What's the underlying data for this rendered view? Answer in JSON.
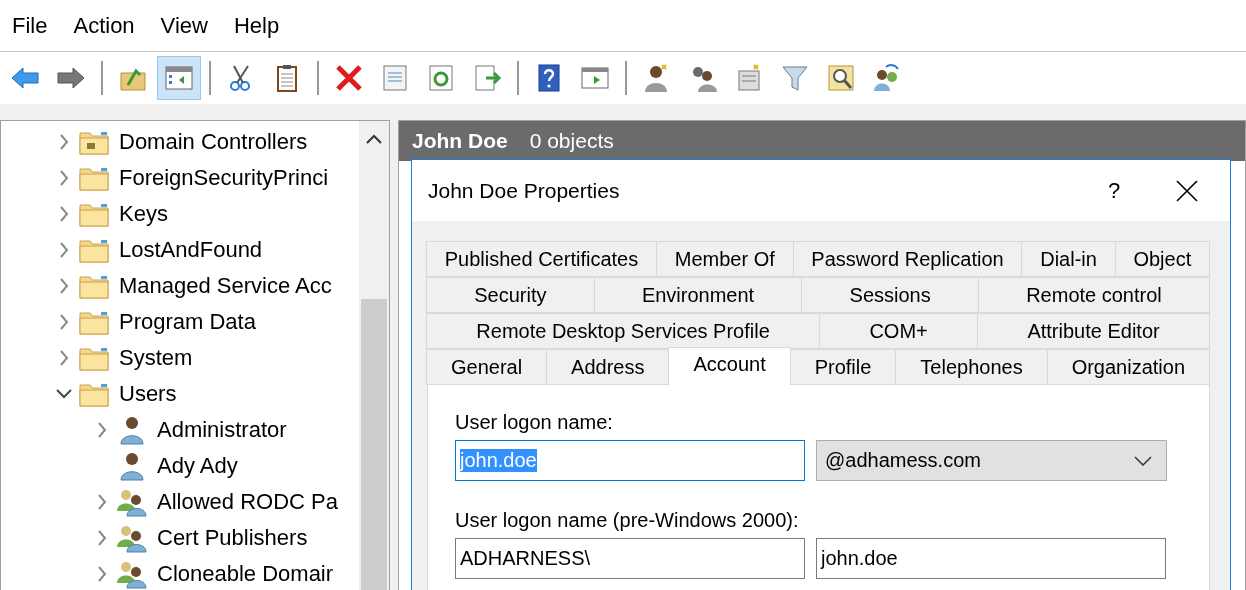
{
  "menu": [
    "File",
    "Action",
    "View",
    "Help"
  ],
  "tree": [
    {
      "label": "Domain Controllers",
      "kind": "ou",
      "expandable": true,
      "expanded": false
    },
    {
      "label": "ForeignSecurityPrinci",
      "kind": "folder",
      "expandable": true,
      "expanded": false
    },
    {
      "label": "Keys",
      "kind": "folder",
      "expandable": true,
      "expanded": false
    },
    {
      "label": "LostAndFound",
      "kind": "folder",
      "expandable": true,
      "expanded": false
    },
    {
      "label": "Managed Service Acc",
      "kind": "folder",
      "expandable": true,
      "expanded": false
    },
    {
      "label": "Program Data",
      "kind": "folder",
      "expandable": true,
      "expanded": false
    },
    {
      "label": "System",
      "kind": "folder",
      "expandable": true,
      "expanded": false
    },
    {
      "label": "Users",
      "kind": "folder",
      "expandable": true,
      "expanded": true,
      "children": [
        {
          "label": "Administrator",
          "kind": "user",
          "expandable": true,
          "expanded": false
        },
        {
          "label": "Ady Ady",
          "kind": "user",
          "expandable": false,
          "expanded": false
        },
        {
          "label": "Allowed RODC Pa",
          "kind": "group",
          "expandable": true,
          "expanded": false
        },
        {
          "label": "Cert Publishers",
          "kind": "group",
          "expandable": true,
          "expanded": false
        },
        {
          "label": "Cloneable Domair",
          "kind": "group",
          "expandable": true,
          "expanded": false
        }
      ]
    }
  ],
  "details_header": {
    "title": "John Doe",
    "count": "0 objects"
  },
  "dialog": {
    "title": "John Doe Properties",
    "help": "?",
    "tab_rows": [
      [
        {
          "label": "Published Certificates",
          "selected": false
        },
        {
          "label": "Member Of",
          "selected": false
        },
        {
          "label": "Password Replication",
          "selected": false
        },
        {
          "label": "Dial-in",
          "selected": false
        },
        {
          "label": "Object",
          "selected": false
        }
      ],
      [
        {
          "label": "Security",
          "selected": false
        },
        {
          "label": "Environment",
          "selected": false
        },
        {
          "label": "Sessions",
          "selected": false
        },
        {
          "label": "Remote control",
          "selected": false
        }
      ],
      [
        {
          "label": "Remote Desktop Services Profile",
          "selected": false
        },
        {
          "label": "COM+",
          "selected": false
        },
        {
          "label": "Attribute Editor",
          "selected": false
        }
      ],
      [
        {
          "label": "General",
          "selected": false
        },
        {
          "label": "Address",
          "selected": false
        },
        {
          "label": "Account",
          "selected": true
        },
        {
          "label": "Profile",
          "selected": false
        },
        {
          "label": "Telephones",
          "selected": false
        },
        {
          "label": "Organization",
          "selected": false
        }
      ]
    ],
    "fields": [
      {
        "label": "User logon name:",
        "inputs": [
          {
            "kind": "text",
            "value": "john.doe",
            "focused": true
          },
          {
            "kind": "dropdown",
            "value": "@adhamess.com",
            "focused": false
          }
        ]
      },
      {
        "label": "User logon name (pre-Windows 2000):",
        "inputs": [
          {
            "kind": "text",
            "value": "ADHARNESS\\",
            "focused": false
          },
          {
            "kind": "text",
            "value": "john.doe",
            "focused": false
          }
        ]
      }
    ]
  }
}
